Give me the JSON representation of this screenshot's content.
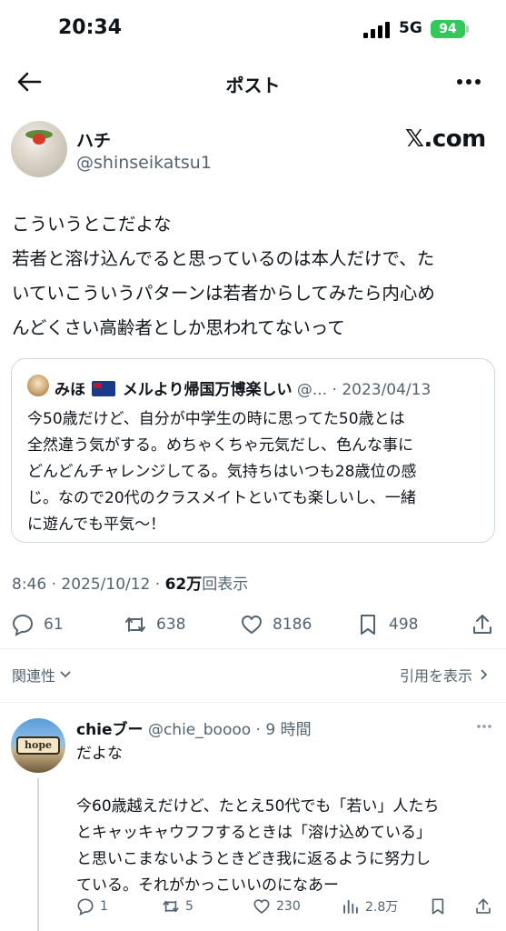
{
  "status_bar": {
    "time": "20:34",
    "network": "5G",
    "battery": "94"
  },
  "nav": {
    "title": "ポスト"
  },
  "post": {
    "author_name": "ハチ",
    "author_handle": "@shinseikatsu1",
    "source_label": "𝕏.com",
    "text_lines": [
      "こういうとこだよな",
      "若者と溶け込んでると思っているのは本人だけで、た",
      "いていこういうパターンは若者からしてみたら内心め",
      "んどくさい高齢者としか思われてないって"
    ],
    "timestamp": "8:46 · 2025/10/12 · ",
    "views_count": "62万",
    "views_label": "回表示"
  },
  "quoted": {
    "name_part1": "みほ",
    "name_part2": "メルより帰国万博楽しい",
    "handle_date": "@... · 2023/04/13",
    "text_lines": [
      "今50歳だけど、自分が中学生の時に思ってた50歳とは",
      "全然違う気がする。めちゃくちゃ元気だし、色んな事に",
      "どんどんチャレンジしてる。気持ちはいつも28歳位の感",
      "じ。なので20代のクラスメイトといても楽しいし、一緒",
      "に遊んでも平気〜！"
    ]
  },
  "actions": {
    "replies": "61",
    "reposts": "638",
    "likes": "8186",
    "bookmarks": "498"
  },
  "sort": {
    "label": "関連性",
    "quotes_link": "引用を表示"
  },
  "reply": {
    "name": "chieブー",
    "handle_time": "@chie_boooo · 9 時間",
    "avatar_sign": "hope",
    "line1": "だよな",
    "text_lines": [
      "今60歳越えだけど、たとえ50代でも「若い」人たち",
      "とキャッキャウフフするときは「溶け込めている」",
      "と思いこまないようときどき我に返るように努力し",
      "ている。それがかっこいいのになあー"
    ],
    "actions": {
      "replies": "1",
      "reposts": "5",
      "likes": "230",
      "views": "2.8万"
    }
  },
  "colors": {
    "text": "#0f1419",
    "muted": "#536471",
    "border": "#cfd9de",
    "battery": "#34c759"
  }
}
